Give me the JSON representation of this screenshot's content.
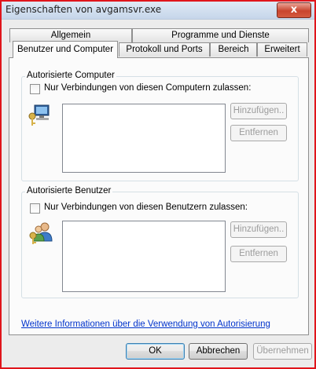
{
  "window": {
    "title": "Eigenschaften von avgamsvr.exe",
    "close_glyph": "x"
  },
  "tabs": {
    "row1": [
      "Allgemein",
      "Programme und Dienste"
    ],
    "row2": [
      "Benutzer und Computer",
      "Protokoll und Ports",
      "Bereich",
      "Erweitert"
    ]
  },
  "computers": {
    "group_label": "Autorisierte Computer",
    "checkbox_label": "Nur Verbindungen von diesen Computern zulassen:",
    "add_button": "Hinzufügen..",
    "remove_button": "Entfernen"
  },
  "users": {
    "group_label": "Autorisierte Benutzer",
    "checkbox_label": "Nur Verbindungen von diesen Benutzern zulassen:",
    "add_button": "Hinzufügen..",
    "remove_button": "Entfernen"
  },
  "info_link": "Weitere Informationen über die Verwendung von Autorisierung",
  "footer": {
    "ok": "OK",
    "cancel": "Abbrechen",
    "apply": "Übernehmen"
  },
  "icons": {
    "computers": "computer-key-icon",
    "users": "users-key-icon"
  }
}
